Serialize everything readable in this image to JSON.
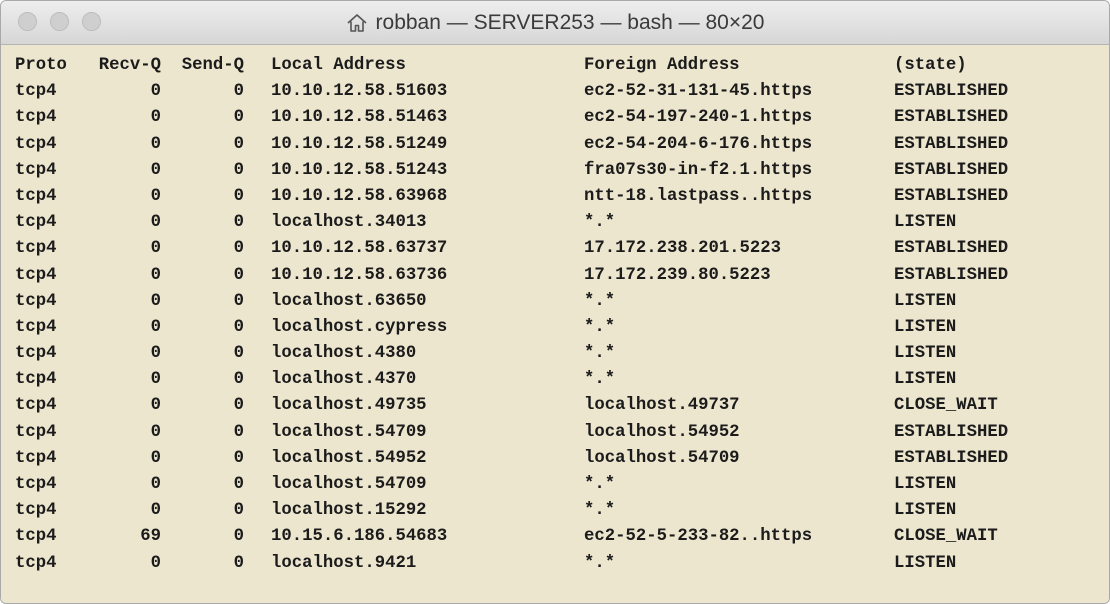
{
  "window": {
    "title": "robban — SERVER253 — bash — 80×20"
  },
  "terminal": {
    "headers": {
      "proto": "Proto",
      "recvq": "Recv-Q",
      "sendq": "Send-Q",
      "local": "Local Address",
      "foreign": "Foreign Address",
      "state": "(state)"
    },
    "rows": [
      {
        "proto": "tcp4",
        "recvq": "0",
        "sendq": "0",
        "local": "10.10.12.58.51603",
        "foreign": "ec2-52-31-131-45.https",
        "state": "ESTABLISHED"
      },
      {
        "proto": "tcp4",
        "recvq": "0",
        "sendq": "0",
        "local": "10.10.12.58.51463",
        "foreign": "ec2-54-197-240-1.https",
        "state": "ESTABLISHED"
      },
      {
        "proto": "tcp4",
        "recvq": "0",
        "sendq": "0",
        "local": "10.10.12.58.51249",
        "foreign": "ec2-54-204-6-176.https",
        "state": "ESTABLISHED"
      },
      {
        "proto": "tcp4",
        "recvq": "0",
        "sendq": "0",
        "local": "10.10.12.58.51243",
        "foreign": "fra07s30-in-f2.1.https",
        "state": "ESTABLISHED"
      },
      {
        "proto": "tcp4",
        "recvq": "0",
        "sendq": "0",
        "local": "10.10.12.58.63968",
        "foreign": "ntt-18.lastpass..https",
        "state": "ESTABLISHED"
      },
      {
        "proto": "tcp4",
        "recvq": "0",
        "sendq": "0",
        "local": "localhost.34013",
        "foreign": "*.*",
        "state": "LISTEN"
      },
      {
        "proto": "tcp4",
        "recvq": "0",
        "sendq": "0",
        "local": "10.10.12.58.63737",
        "foreign": "17.172.238.201.5223",
        "state": "ESTABLISHED"
      },
      {
        "proto": "tcp4",
        "recvq": "0",
        "sendq": "0",
        "local": "10.10.12.58.63736",
        "foreign": "17.172.239.80.5223",
        "state": "ESTABLISHED"
      },
      {
        "proto": "tcp4",
        "recvq": "0",
        "sendq": "0",
        "local": "localhost.63650",
        "foreign": "*.*",
        "state": "LISTEN"
      },
      {
        "proto": "tcp4",
        "recvq": "0",
        "sendq": "0",
        "local": "localhost.cypress",
        "foreign": "*.*",
        "state": "LISTEN"
      },
      {
        "proto": "tcp4",
        "recvq": "0",
        "sendq": "0",
        "local": "localhost.4380",
        "foreign": "*.*",
        "state": "LISTEN"
      },
      {
        "proto": "tcp4",
        "recvq": "0",
        "sendq": "0",
        "local": "localhost.4370",
        "foreign": "*.*",
        "state": "LISTEN"
      },
      {
        "proto": "tcp4",
        "recvq": "0",
        "sendq": "0",
        "local": "localhost.49735",
        "foreign": "localhost.49737",
        "state": "CLOSE_WAIT"
      },
      {
        "proto": "tcp4",
        "recvq": "0",
        "sendq": "0",
        "local": "localhost.54709",
        "foreign": "localhost.54952",
        "state": "ESTABLISHED"
      },
      {
        "proto": "tcp4",
        "recvq": "0",
        "sendq": "0",
        "local": "localhost.54952",
        "foreign": "localhost.54709",
        "state": "ESTABLISHED"
      },
      {
        "proto": "tcp4",
        "recvq": "0",
        "sendq": "0",
        "local": "localhost.54709",
        "foreign": "*.*",
        "state": "LISTEN"
      },
      {
        "proto": "tcp4",
        "recvq": "0",
        "sendq": "0",
        "local": "localhost.15292",
        "foreign": "*.*",
        "state": "LISTEN"
      },
      {
        "proto": "tcp4",
        "recvq": "69",
        "sendq": "0",
        "local": "10.15.6.186.54683",
        "foreign": "ec2-52-5-233-82..https",
        "state": "CLOSE_WAIT"
      },
      {
        "proto": "tcp4",
        "recvq": "0",
        "sendq": "0",
        "local": "localhost.9421",
        "foreign": "*.*",
        "state": "LISTEN"
      }
    ]
  }
}
